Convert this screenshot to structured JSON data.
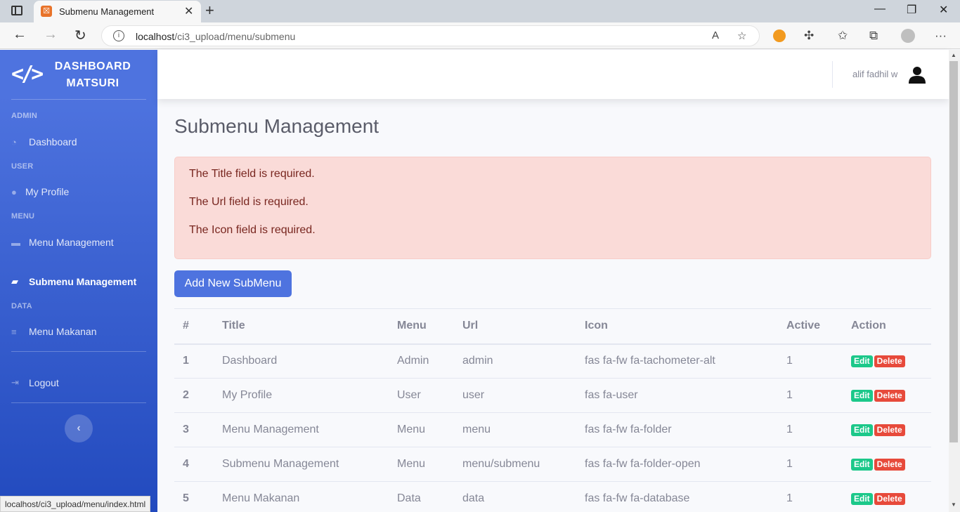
{
  "browser": {
    "tab_title": "Submenu Management",
    "url_host": "localhost",
    "url_path": "/ci3_upload/menu/submenu",
    "status_url": "localhost/ci3_upload/menu/index.html"
  },
  "sidebar": {
    "brand_line1": "DASHBOARD",
    "brand_line2": "MATSURI",
    "headings": [
      "ADMIN",
      "USER",
      "MENU",
      "DATA"
    ],
    "items": [
      {
        "label": "Dashboard",
        "icon": "tachometer-icon"
      },
      {
        "label": "My Profile",
        "icon": "user-icon"
      },
      {
        "label": "Menu Management",
        "icon": "folder-icon"
      },
      {
        "label": "Submenu Management",
        "icon": "folder-open-icon",
        "active": true
      },
      {
        "label": "Menu Makanan",
        "icon": "database-icon"
      },
      {
        "label": "Logout",
        "icon": "sign-out-icon"
      }
    ],
    "toggle_icon": "chevron-left-icon"
  },
  "topbar": {
    "user_name": "alif fadhil w"
  },
  "main": {
    "title": "Submenu Management",
    "errors": [
      "The Title field is required.",
      "The Url field is required.",
      "The Icon field is required."
    ],
    "add_button": "Add New SubMenu",
    "table": {
      "headers": [
        "#",
        "Title",
        "Menu",
        "Url",
        "Icon",
        "Active",
        "Action"
      ],
      "rows": [
        {
          "num": "1",
          "title": "Dashboard",
          "menu": "Admin",
          "url": "admin",
          "icon": "fas fa-fw fa-tachometer-alt",
          "active": "1"
        },
        {
          "num": "2",
          "title": "My Profile",
          "menu": "User",
          "url": "user",
          "icon": "fas fa-user",
          "active": "1"
        },
        {
          "num": "3",
          "title": "Menu Management",
          "menu": "Menu",
          "url": "menu",
          "icon": "fas fa-fw fa-folder",
          "active": "1"
        },
        {
          "num": "4",
          "title": "Submenu Management",
          "menu": "Menu",
          "url": "menu/submenu",
          "icon": "fas fa-fw fa-folder-open",
          "active": "1"
        },
        {
          "num": "5",
          "title": "Menu Makanan",
          "menu": "Data",
          "url": "data",
          "icon": "fas fa-fw fa-database",
          "active": "1"
        }
      ],
      "edit_label": "Edit",
      "delete_label": "Delete"
    }
  },
  "colors": {
    "primary": "#4e73df",
    "success": "#1cc88a",
    "danger": "#e74a3b",
    "alert_bg": "#fadbd8"
  }
}
